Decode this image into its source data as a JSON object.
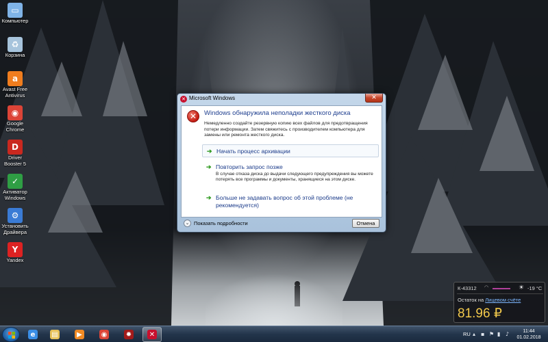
{
  "desktop_icons": [
    {
      "name": "computer-icon",
      "label": "Компьютер",
      "color": "#7fb3e6",
      "glyph": "▭"
    },
    {
      "name": "recycle-bin-icon",
      "label": "Корзина",
      "color": "#a7c4dc",
      "glyph": "♻"
    },
    {
      "name": "avast-icon",
      "label": "Avast Free Antivirus",
      "color": "#f07d1e",
      "glyph": "a"
    },
    {
      "name": "chrome-icon",
      "label": "Google Chrome",
      "color": "#dc4437",
      "glyph": "◉"
    },
    {
      "name": "driver-booster-icon",
      "label": "Driver Booster 5",
      "color": "#c9281f",
      "glyph": "D"
    },
    {
      "name": "activator-icon",
      "label": "Активатор Windows",
      "color": "#2f9e44",
      "glyph": "✓"
    },
    {
      "name": "driver-install-icon",
      "label": "Установить Драйвера",
      "color": "#3a7bd5",
      "glyph": "⚙"
    },
    {
      "name": "yandex-icon",
      "label": "Yandex",
      "color": "#d22",
      "glyph": "Y"
    }
  ],
  "dialog": {
    "title": "Microsoft Windows",
    "main_instruction": "Windows обнаружила неполадки жесткого диска",
    "content": "Немедленно создайте резервную копию всех файлов для предотвращения потери информации. Затем свяжитесь с производителем компьютера для замены или ремонта жесткого диска.",
    "commands": [
      {
        "text": "Начать процесс архивации",
        "sub": ""
      },
      {
        "text": "Повторить запрос позже",
        "sub": "В случае отказа диска до выдачи следующего предупреждения вы можете потерять все программы и документы, хранящиеся на этом диске."
      },
      {
        "text": "Больше не задавать вопрос об этой проблеме (не рекомендуется)",
        "sub": ""
      }
    ],
    "details_label": "Показать подробности",
    "cancel_label": "Отмена"
  },
  "gadget": {
    "account": "К-43312",
    "temperature": "-19 °C",
    "remainder_prefix": "Остаток на",
    "remainder_link": "Лицевом счёте",
    "amount": "81.96 ₽"
  },
  "taskbar": {
    "apps": [
      {
        "name": "ie-icon",
        "color": "#3a8ee6",
        "glyph": "e",
        "active": false
      },
      {
        "name": "explorer-icon",
        "color": "#e7c25a",
        "glyph": "▤",
        "active": false
      },
      {
        "name": "media-player-icon",
        "color": "#f08a24",
        "glyph": "▶",
        "active": false
      },
      {
        "name": "chrome-icon",
        "color": "#dc4437",
        "glyph": "◉",
        "active": false
      },
      {
        "name": "app-red-icon",
        "color": "#a31a1a",
        "glyph": "✹",
        "active": false
      },
      {
        "name": "error-dialog-icon",
        "color": "#c8102e",
        "glyph": "✕",
        "active": true
      }
    ],
    "language": "RU",
    "time": "11:44",
    "date": "01.02.2018"
  }
}
